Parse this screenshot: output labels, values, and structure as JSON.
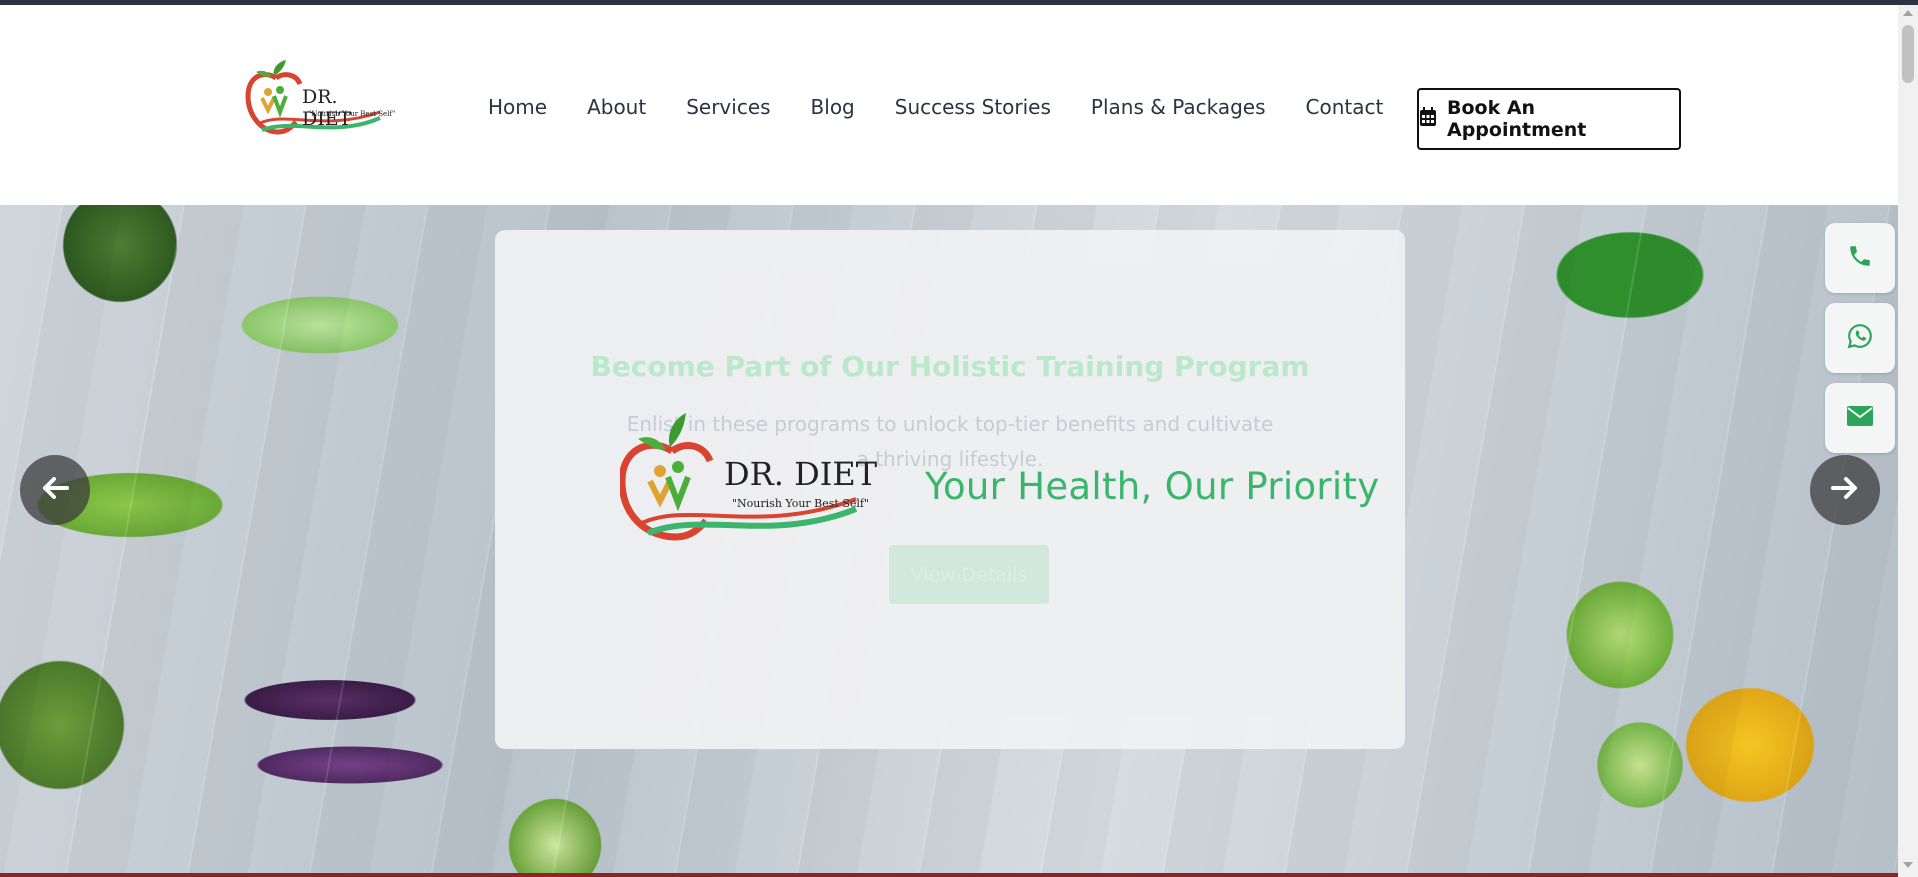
{
  "brand": {
    "name": "DR. DIET",
    "slogan": "\"Nourish Your Best Self\""
  },
  "nav": {
    "items": [
      "Home",
      "About",
      "Services",
      "Blog",
      "Success Stories",
      "Plans & Packages",
      "Contact"
    ]
  },
  "header": {
    "cta_label": "Book An Appointment",
    "cta_icon": "calendar-icon"
  },
  "hero": {
    "background_title": "Become Part of Our Holistic Training Program",
    "background_subtitle": "Enlist in these programs to unlock top-tier benefits and cultivate a thriving lifestyle.",
    "background_button": "View Details",
    "tagline": "Your Health, Our Priority",
    "prev_icon": "arrow-left-icon",
    "next_icon": "arrow-right-icon"
  },
  "contact_float": {
    "items": [
      "phone-icon",
      "whatsapp-icon",
      "email-icon"
    ]
  },
  "colors": {
    "brand_green": "#3bb56b",
    "brand_red": "#d8442f",
    "text_dark": "#2b3440"
  }
}
